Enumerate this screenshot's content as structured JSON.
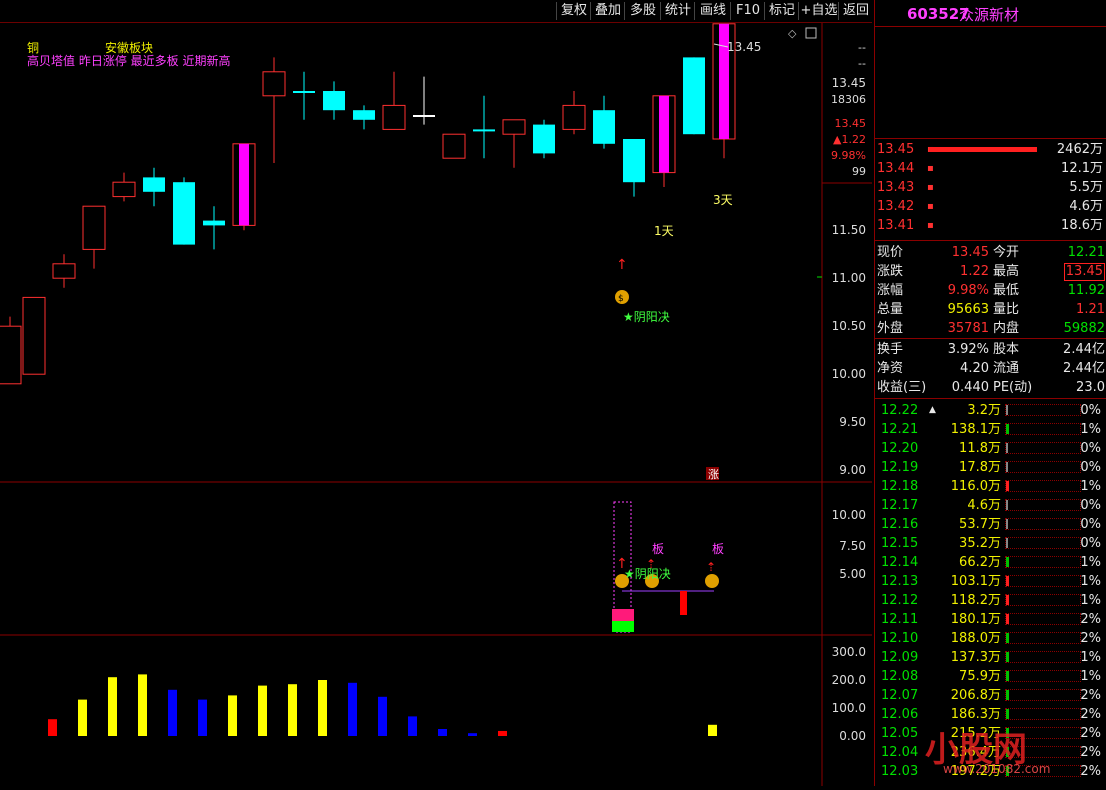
{
  "toolbar": {
    "buttons": [
      "复权",
      "叠加",
      "多股",
      "统计",
      "画线",
      "F10",
      "标记",
      "+自选",
      "返回"
    ]
  },
  "stock": {
    "code": "603527",
    "name": "众源新材"
  },
  "indicator_labels": {
    "line1_left": "铜",
    "line1_right": "安徽板块",
    "line2": "高贝塔值 昨日涨停 最近多板 近期新高"
  },
  "price_axis": {
    "ticks": [
      "11.50",
      "11.00",
      "10.50",
      "10.00",
      "9.50",
      "9.00"
    ],
    "top_box": [
      "--",
      "--",
      "13.45",
      "18306",
      "13.45",
      "▲1.22",
      "9.98%",
      "99"
    ]
  },
  "sub_axis": {
    "ticks": [
      "10.00",
      "7.50",
      "5.00"
    ]
  },
  "vol_axis": {
    "ticks": [
      "300.0",
      "200.0",
      "100.0",
      "0.00"
    ]
  },
  "annotations": {
    "high_price": "13.45",
    "day1": "1天",
    "day3": "3天",
    "yinyang": "★阴阳决",
    "yinyang_sub": "★阴阳决",
    "ban1": "板",
    "ban2": "板",
    "zhang": "涨"
  },
  "asks": [
    {
      "price": "13.45",
      "vol": "2462万"
    },
    {
      "price": "13.44",
      "vol": "12.1万"
    },
    {
      "price": "13.43",
      "vol": "5.5万"
    },
    {
      "price": "13.42",
      "vol": "4.6万"
    },
    {
      "price": "13.41",
      "vol": "18.6万"
    }
  ],
  "quote": [
    {
      "l1": "现价",
      "v1": "13.45",
      "l2": "今开",
      "v2": "12.21"
    },
    {
      "l1": "涨跌",
      "v1": "1.22",
      "l2": "最高",
      "v2": "13.45"
    },
    {
      "l1": "涨幅",
      "v1": "9.98%",
      "l2": "最低",
      "v2": "11.92"
    },
    {
      "l1": "总量",
      "v1": "95663",
      "l2": "量比",
      "v2": "1.21"
    },
    {
      "l1": "外盘",
      "v1": "35781",
      "l2": "内盘",
      "v2": "59882"
    }
  ],
  "fundamentals": [
    {
      "l1": "换手",
      "v1": "3.92%",
      "l2": "股本",
      "v2": "2.44亿"
    },
    {
      "l1": "净资",
      "v1": "4.20",
      "l2": "流通",
      "v2": "2.44亿"
    },
    {
      "l1": "收益(三)",
      "v1": "0.440",
      "l2": "PE(动)",
      "v2": "23.0"
    }
  ],
  "distribution": [
    {
      "price": "12.22",
      "vol": "3.2万",
      "pct": "0%",
      "frac": 0.0
    },
    {
      "price": "12.21",
      "vol": "138.1万",
      "pct": "1%",
      "frac": 0.01
    },
    {
      "price": "12.20",
      "vol": "11.8万",
      "pct": "0%",
      "frac": 0.0
    },
    {
      "price": "12.19",
      "vol": "17.8万",
      "pct": "0%",
      "frac": 0.0
    },
    {
      "price": "12.18",
      "vol": "116.0万",
      "pct": "1%",
      "frac": 0.01
    },
    {
      "price": "12.17",
      "vol": "4.6万",
      "pct": "0%",
      "frac": 0.0
    },
    {
      "price": "12.16",
      "vol": "53.7万",
      "pct": "0%",
      "frac": 0.0
    },
    {
      "price": "12.15",
      "vol": "35.2万",
      "pct": "0%",
      "frac": 0.0
    },
    {
      "price": "12.14",
      "vol": "66.2万",
      "pct": "1%",
      "frac": 0.01
    },
    {
      "price": "12.13",
      "vol": "103.1万",
      "pct": "1%",
      "frac": 0.01
    },
    {
      "price": "12.12",
      "vol": "118.2万",
      "pct": "1%",
      "frac": 0.01
    },
    {
      "price": "12.11",
      "vol": "180.1万",
      "pct": "2%",
      "frac": 0.02
    },
    {
      "price": "12.10",
      "vol": "188.0万",
      "pct": "2%",
      "frac": 0.02
    },
    {
      "price": "12.09",
      "vol": "137.3万",
      "pct": "1%",
      "frac": 0.01
    },
    {
      "price": "12.08",
      "vol": "75.9万",
      "pct": "1%",
      "frac": 0.01
    },
    {
      "price": "12.07",
      "vol": "206.8万",
      "pct": "2%",
      "frac": 0.02
    },
    {
      "price": "12.06",
      "vol": "186.3万",
      "pct": "2%",
      "frac": 0.02
    },
    {
      "price": "12.05",
      "vol": "215.2万",
      "pct": "2%",
      "frac": 0.02
    },
    {
      "price": "12.04",
      "vol": "236.4万",
      "pct": "2%",
      "frac": 0.02
    },
    {
      "price": "12.03",
      "vol": "197.2万",
      "pct": "2%",
      "frac": 0.02
    }
  ],
  "watermark": {
    "text": "小股网",
    "url": "www.201082.com"
  },
  "colors": {
    "up": "#ff3030",
    "down": "#00ffff",
    "ban": "#ff00ff",
    "vol_yellow": "#ffff00",
    "vol_blue": "#0000ff",
    "frame": "#8b0000"
  }
}
